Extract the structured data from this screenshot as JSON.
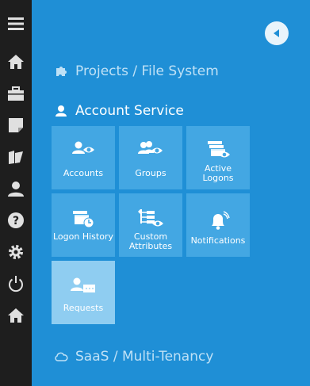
{
  "sections": {
    "projects": {
      "label": "Projects / File System",
      "icon": "puzzle-icon"
    },
    "account_service": {
      "label": "Account Service",
      "icon": "user-icon"
    },
    "saas": {
      "label": "SaaS / Multi-Tenancy",
      "icon": "cloud-icon"
    }
  },
  "tiles": [
    {
      "label": "Accounts",
      "icon": "user-eye-icon"
    },
    {
      "label": "Groups",
      "icon": "group-eye-icon"
    },
    {
      "label": "Active Logons",
      "icon": "active-logons-icon"
    },
    {
      "label": "Logon History",
      "icon": "logon-history-icon"
    },
    {
      "label": "Custom Attributes",
      "icon": "custom-attributes-icon"
    },
    {
      "label": "Notifications",
      "icon": "bell-icon"
    },
    {
      "label": "Requests",
      "icon": "user-request-icon",
      "selected": true
    }
  ],
  "rail": [
    "hamburger-menu-icon",
    "home-icon",
    "briefcase-icon",
    "note-icon",
    "folder-open-icon",
    "user-icon",
    "help-icon",
    "gear-icon",
    "power-icon",
    "home-icon"
  ],
  "colors": {
    "panel": "#1f8fd6",
    "tile": "#43a7e3",
    "tile_selected": "#8fcdf1",
    "rail": "#1e1e1e"
  }
}
